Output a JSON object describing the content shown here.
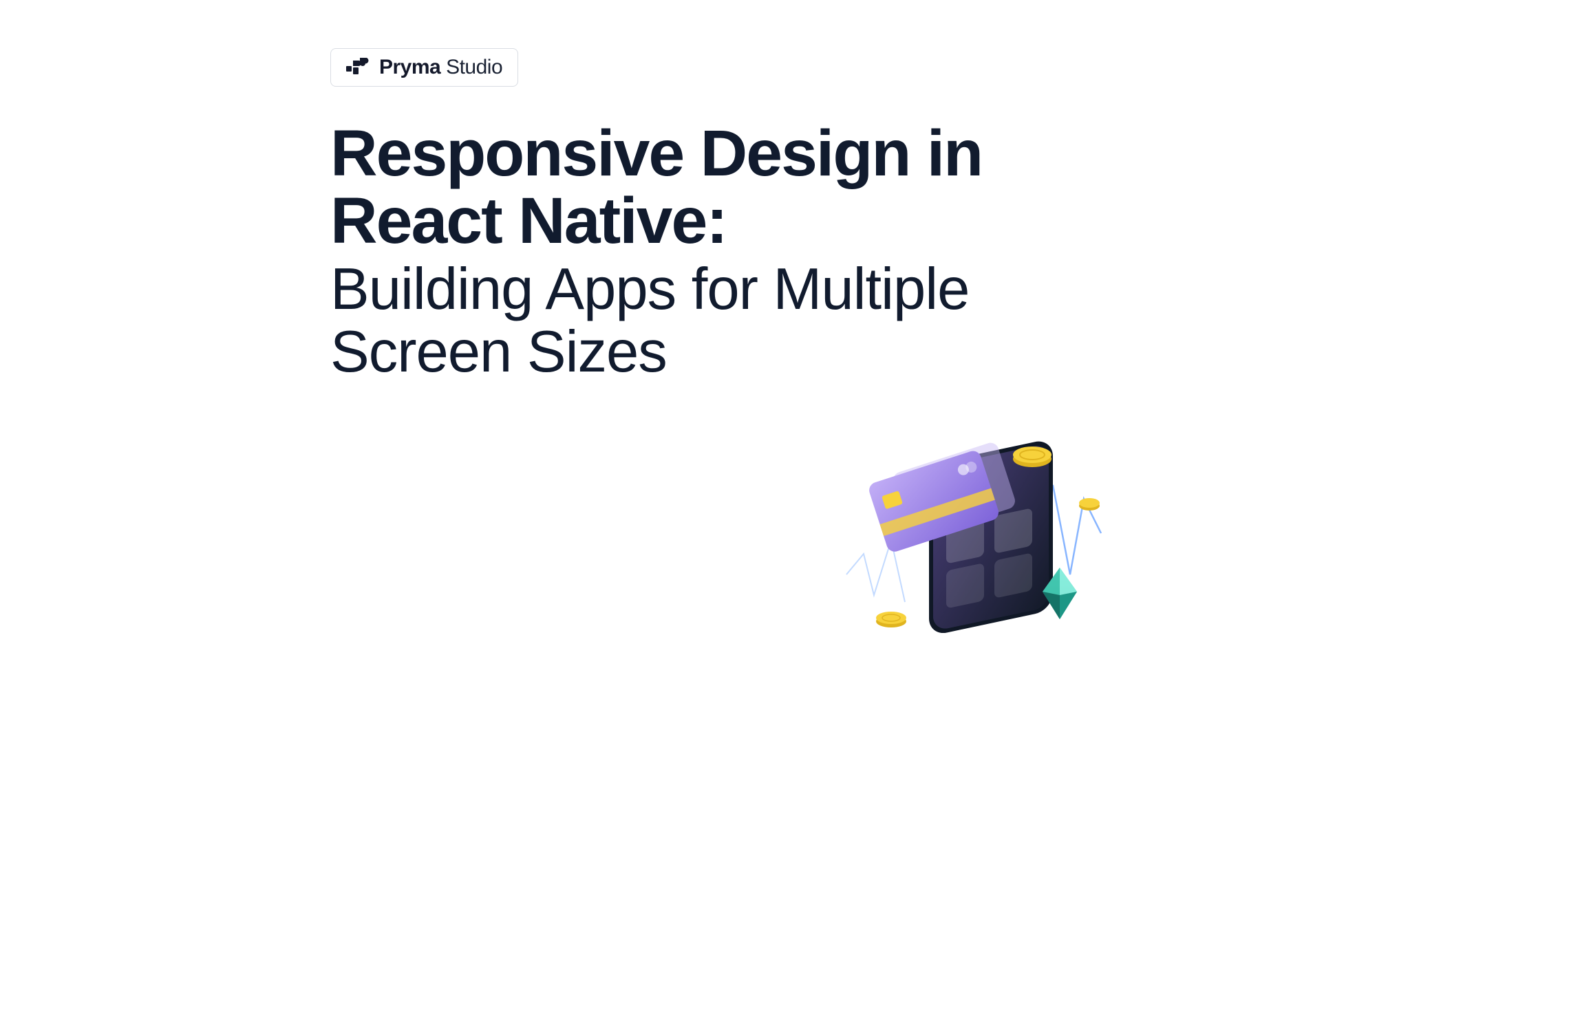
{
  "brand": {
    "logo_name": "Pryma",
    "logo_suffix": " Studio"
  },
  "headline": {
    "strong": "Responsive Design in React Native:",
    "light": "Building Apps for Multiple Screen Sizes"
  },
  "illustration": {
    "name": "phone-finance-illustration",
    "elements": [
      "smartphone",
      "credit-card",
      "coins",
      "crystal",
      "zigzag-line"
    ]
  },
  "colors": {
    "text_dark": "#111b2e",
    "brand_purple": "#8f7be7",
    "brand_purple_light": "#c6b6f5",
    "coin_gold": "#f7d23b",
    "coin_gold_dark": "#e0b41f",
    "phone_dark": "#1d2a3b",
    "crystal_teal": "#2fb8a6",
    "zig_blue": "#6aa3ff"
  }
}
